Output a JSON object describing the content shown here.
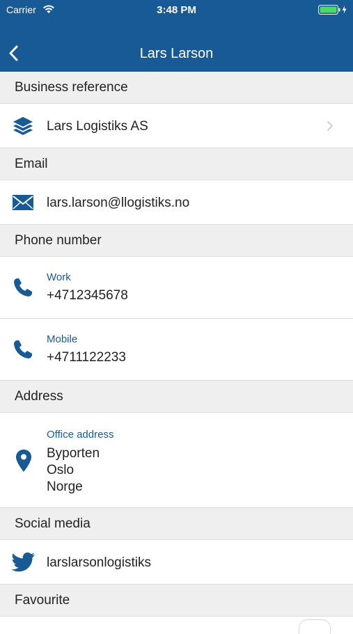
{
  "status": {
    "carrier": "Carrier",
    "time": "3:48 PM"
  },
  "nav": {
    "title": "Lars Larson"
  },
  "sections": {
    "business": "Business reference",
    "email": "Email",
    "phone": "Phone number",
    "address": "Address",
    "social": "Social media",
    "favourite": "Favourite"
  },
  "business": {
    "company": "Lars Logistiks AS"
  },
  "email": {
    "address": "lars.larson@llogistiks.no"
  },
  "phones": [
    {
      "label": "Work",
      "number": "+4712345678"
    },
    {
      "label": "Mobile",
      "number": "+4711122233"
    }
  ],
  "address": {
    "label": "Office address",
    "lines": [
      "Byporten",
      "Oslo",
      "Norge"
    ]
  },
  "social": {
    "handle": "larslarsonlogistiks"
  },
  "colors": {
    "brand": "#175a95",
    "section_bg": "#efefef",
    "battery": "#4cd964"
  },
  "icons": [
    "wifi-icon",
    "battery-icon",
    "back-chevron-icon",
    "layers-icon",
    "chevron-right-icon",
    "envelope-icon",
    "phone-icon",
    "map-pin-icon",
    "twitter-icon"
  ]
}
